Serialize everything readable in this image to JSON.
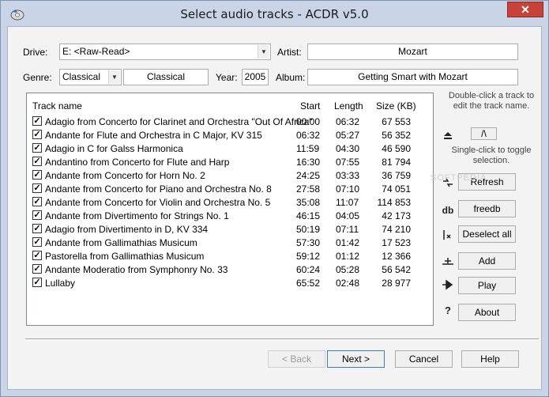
{
  "window": {
    "title": "Select audio tracks - ACDR v5.0",
    "close_glyph": "✕"
  },
  "form": {
    "drive_label": "Drive:",
    "drive_value": "E: <Raw-Read>",
    "artist_label": "Artist:",
    "artist_value": "Mozart",
    "genre_label": "Genre:",
    "genre_value": "Classical",
    "genre_text": "Classical",
    "year_label": "Year:",
    "year_value": "2005",
    "album_label": "Album:",
    "album_value": "Getting Smart with Mozart"
  },
  "tracklist": {
    "headers": {
      "name": "Track name",
      "start": "Start",
      "length": "Length",
      "size": "Size (KB)"
    },
    "rows": [
      {
        "name": "Adagio from Concerto for Clarinet and Orchestra \"Out Of Africa\"",
        "start": "00:00",
        "length": "06:32",
        "size": "67 553",
        "checked": true
      },
      {
        "name": "Andante for Flute and Orchestra in C Major, KV 315",
        "start": "06:32",
        "length": "05:27",
        "size": "56 352",
        "checked": true
      },
      {
        "name": "Adagio in C for Galss Harmonica",
        "start": "11:59",
        "length": "04:30",
        "size": "46 590",
        "checked": true
      },
      {
        "name": "Andantino from Concerto for Flute and Harp",
        "start": "16:30",
        "length": "07:55",
        "size": "81 794",
        "checked": true
      },
      {
        "name": "Andante from Concerto for Horn No. 2",
        "start": "24:25",
        "length": "03:33",
        "size": "36 759",
        "checked": true
      },
      {
        "name": "Andante from Concerto for Piano and Orchestra No. 8",
        "start": "27:58",
        "length": "07:10",
        "size": "74 051",
        "checked": true
      },
      {
        "name": "Andante from Concerto for Violin and Orchestra No. 5",
        "start": "35:08",
        "length": "11:07",
        "size": "114 853",
        "checked": true
      },
      {
        "name": "Andante from Divertimento for Strings No. 1",
        "start": "46:15",
        "length": "04:05",
        "size": "42 173",
        "checked": true
      },
      {
        "name": "Adagio from Divertimento in D, KV 334",
        "start": "50:19",
        "length": "07:11",
        "size": "74 210",
        "checked": true
      },
      {
        "name": "Andante from Gallimathias Musicum",
        "start": "57:30",
        "length": "01:42",
        "size": "17 523",
        "checked": true
      },
      {
        "name": "Pastorella from Gallimathias Musicum",
        "start": "59:12",
        "length": "01:12",
        "size": "12 366",
        "checked": true
      },
      {
        "name": "Andante Moderatio from Symphonry No. 33",
        "start": "60:24",
        "length": "05:28",
        "size": "56 542",
        "checked": true
      },
      {
        "name": "Lullaby",
        "start": "65:52",
        "length": "02:48",
        "size": "28 977",
        "checked": true
      }
    ]
  },
  "side": {
    "hint_edit": "Double-click a track to edit the track name.",
    "eject_button": "/\\",
    "hint_select": "Single-click to toggle selection.",
    "refresh": "Refresh",
    "freedb_icon_text": "db",
    "freedb": "freedb",
    "deselect_all": "Deselect all",
    "add": "Add",
    "play": "Play",
    "about_icon_text": "?",
    "about": "About"
  },
  "footer": {
    "back": "< Back",
    "next": "Next >",
    "cancel": "Cancel",
    "help": "Help"
  },
  "watermark": "SOFTPEDIA"
}
